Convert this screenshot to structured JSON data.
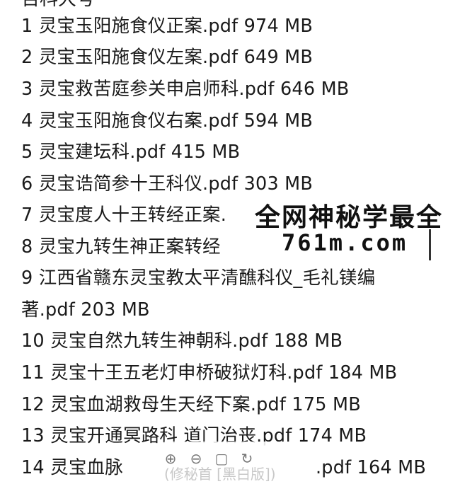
{
  "header": {
    "cut_text": "百科大号"
  },
  "files": [
    {
      "line1": "1 灵宝玉阳施食仪正案.pdf 974 MB"
    },
    {
      "line1": "2 灵宝玉阳施食仪左案.pdf 649 MB"
    },
    {
      "line1": "3 灵宝救苦庭参关申启师科.pdf 646 MB"
    },
    {
      "line1": "4 灵宝玉阳施食仪右案.pdf 594 MB"
    },
    {
      "line1": "5 灵宝建坛科.pdf 415 MB"
    },
    {
      "line1": "6 灵宝诰简参十王科仪.pdf 303 MB"
    },
    {
      "line1": "7 灵宝度人十王转经正案."
    },
    {
      "line1": "8 灵宝九转生神正案转经"
    },
    {
      "line1": "9 江西省赣东灵宝教太平清醮科仪_毛礼镁编",
      "line2": "著.pdf 203 MB"
    },
    {
      "line1": "10 灵宝自然九转生神朝科.pdf 188 MB"
    },
    {
      "line1": "11 灵宝十王五老灯申桥破狱灯科.pdf 184 MB"
    },
    {
      "line1": "12 灵宝血湖救母生天经下案.pdf 175 MB"
    },
    {
      "line1": "13 灵宝开通冥路科 道门治丧.pdf 174 MB"
    },
    {
      "line1": "14 灵宝血脉"
    },
    {
      "line1": ".pdf 164 MB"
    }
  ],
  "watermark": {
    "line1": "全网神秘学最全",
    "line2": "761m.com"
  },
  "toolbar": {
    "icons": [
      "zoom-in-icon",
      "zoom-out-icon",
      "fit-screen-icon",
      "rotate-icon"
    ],
    "overlay_text": "(修秘首  [黑白版])"
  }
}
